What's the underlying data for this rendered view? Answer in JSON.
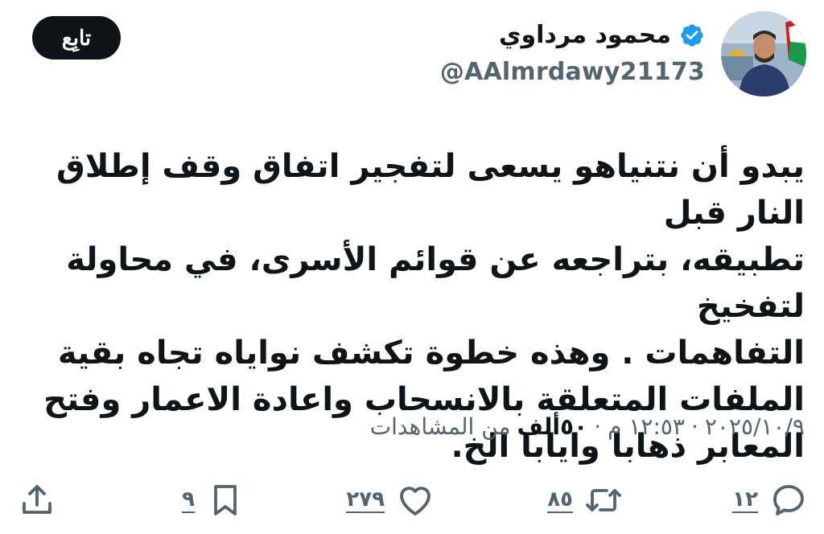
{
  "author": {
    "display_name": "محمود مرداوي",
    "handle": "@AAlmrdawy21173",
    "verified": true
  },
  "follow_button": {
    "label": "تابِع"
  },
  "tweet": {
    "text": "يبدو أن نتنياهو يسعى لتفجير اتفاق وقف إطلاق النار قبل\nتطبيقه، بتراجعه عن قوائم الأسرى، في محاولة لتفخيخ\nالتفاهمات . وهذه خطوة تكشف نواياه تجاه بقية\nالملفات المتعلقة بالانسحاب واعادة الاعمار وفتح\nالمعابر ذهابا وايابا الخ."
  },
  "meta": {
    "time": "١٢:٥٣ م",
    "date": "٢٠٢٥/١٠/٩",
    "separator": "·",
    "views_count": "٥٠ألف",
    "views_label": "من المشاهدات"
  },
  "actions": {
    "replies": "١٢",
    "retweets": "٨٥",
    "likes": "٢٧٩",
    "bookmarks": "٩"
  },
  "colors": {
    "text_primary": "#0f1419",
    "text_secondary": "#536471",
    "verified_blue": "#1d9bf0",
    "follow_bg": "#0f1419"
  },
  "icons": {
    "verified": "verified-badge-icon",
    "reply": "reply-icon",
    "retweet": "retweet-icon",
    "like": "heart-icon",
    "bookmark": "bookmark-icon",
    "share": "share-icon"
  }
}
